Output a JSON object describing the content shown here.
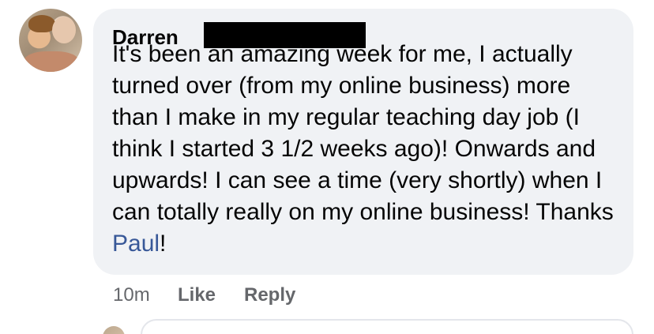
{
  "comment": {
    "author_name": "Darren",
    "text_before_mention": "It's been an amazing week for me, I actually turned over (from my online business) more than I make in my regular teaching day job (I think I started 3 1/2 weeks ago)! Onwards and upwards! I can see a time (very shortly) when I can totally really on my online business! Thanks ",
    "mention": "Paul",
    "text_after_mention": "!",
    "timestamp": "10m",
    "like_label": "Like",
    "reply_label": "Reply"
  },
  "colors": {
    "bubble_bg": "#f0f2f5",
    "text": "#050505",
    "secondary_text": "#65676b",
    "mention": "#385898"
  },
  "icons": {
    "avatar": "profile-photo",
    "reply_avatar": "profile-photo"
  }
}
